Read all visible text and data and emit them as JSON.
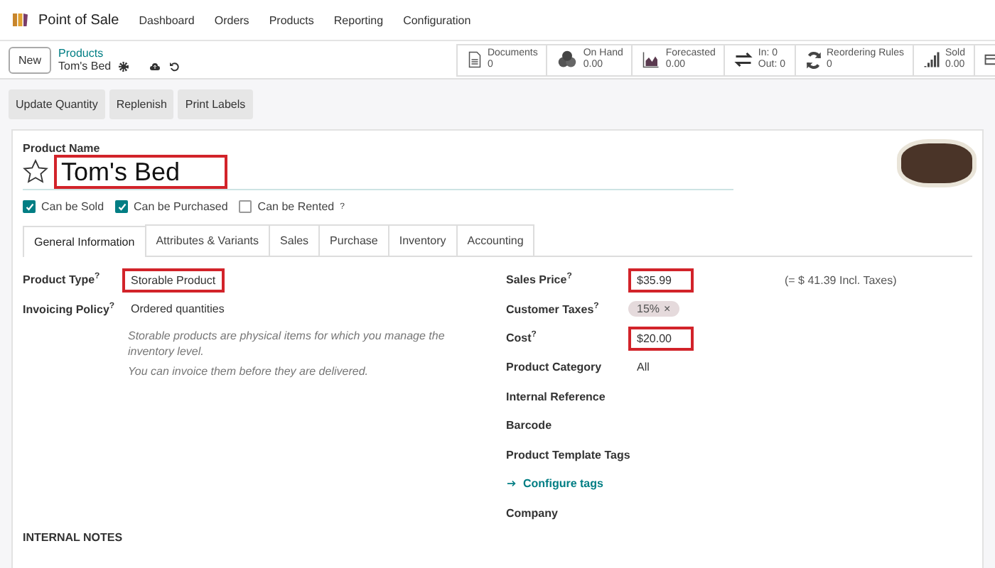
{
  "app": {
    "title": "Point of Sale",
    "menu": [
      "Dashboard",
      "Orders",
      "Products",
      "Reporting",
      "Configuration"
    ]
  },
  "control": {
    "new_button": "New",
    "breadcrumb": "Products",
    "record": "Tom's Bed"
  },
  "stats": [
    {
      "kind": "documents",
      "label": "Documents",
      "value": "0"
    },
    {
      "kind": "cubes",
      "label": "On Hand",
      "value": "0.00"
    },
    {
      "kind": "chart",
      "label": "Forecasted",
      "value": "0.00"
    },
    {
      "kind": "arrows",
      "label": "In: 0",
      "value": "Out: 0"
    },
    {
      "kind": "refresh",
      "label": "Reordering Rules",
      "value": "0"
    },
    {
      "kind": "signal",
      "label": "Sold",
      "value": "0.00"
    }
  ],
  "actions": [
    "Update Quantity",
    "Replenish",
    "Print Labels"
  ],
  "form": {
    "name_label": "Product Name",
    "name": "Tom's Bed",
    "name_highlighted": true,
    "checks": [
      {
        "label": "Can be Sold",
        "checked": true
      },
      {
        "label": "Can be Purchased",
        "checked": true
      },
      {
        "label": "Can be Rented",
        "checked": false,
        "help": "?"
      }
    ],
    "tabs": [
      {
        "label": "General Information",
        "selected": true
      },
      {
        "label": "Attributes & Variants",
        "selected": false
      },
      {
        "label": "Sales",
        "selected": false
      },
      {
        "label": "Purchase",
        "selected": false
      },
      {
        "label": "Inventory",
        "selected": false
      },
      {
        "label": "Accounting",
        "selected": false
      }
    ],
    "left_fields": [
      {
        "label": "Product Type",
        "help": "?",
        "value": "Storable Product",
        "highlighted": true
      },
      {
        "label": "Invoicing Policy",
        "help": "?",
        "value": "Ordered quantities",
        "highlighted": false
      }
    ],
    "notes": [
      "Storable products are physical items for which you manage the inventory level.",
      "You can invoice them before they are delivered."
    ],
    "right_fields": [
      {
        "kind": "text",
        "label": "Sales Price",
        "help": "?",
        "value": "$35.99",
        "highlighted": true,
        "extra": "(= $ 41.39 Incl. Taxes)"
      },
      {
        "kind": "tag",
        "label": "Customer Taxes",
        "help": "?",
        "value": "15%",
        "remove": "×"
      },
      {
        "kind": "text",
        "label": "Cost",
        "help": "?",
        "value": "$20.00",
        "highlighted": true
      },
      {
        "kind": "text",
        "label": "Product Category",
        "value": "All",
        "highlighted": false
      },
      {
        "kind": "text",
        "label": "Internal Reference"
      },
      {
        "kind": "text",
        "label": "Barcode"
      },
      {
        "kind": "text",
        "label": "Product Template Tags"
      },
      {
        "kind": "link",
        "label": "Configure tags"
      },
      {
        "kind": "text",
        "label": "Company"
      }
    ],
    "section": "INTERNAL NOTES"
  }
}
